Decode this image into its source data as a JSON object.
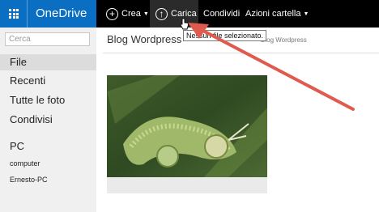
{
  "app": {
    "name": "OneDrive"
  },
  "toolbar": {
    "crea_label": "Crea",
    "carica_label": "Carica",
    "condividi_label": "Condividi",
    "azioni_label": "Azioni cartella"
  },
  "sidebar": {
    "search_placeholder": "Cerca",
    "items": [
      {
        "label": "File"
      },
      {
        "label": "Recenti"
      },
      {
        "label": "Tutte le foto"
      },
      {
        "label": "Condivisi"
      }
    ],
    "pc_header": "PC",
    "pcs": [
      {
        "label": "computer"
      },
      {
        "label": "Ernesto-PC"
      }
    ]
  },
  "main": {
    "breadcrumb": "Blog Wordpress",
    "breadcrumb_faint": "Blog Wordpress"
  },
  "tooltip": {
    "text": "Nessun file selezionato."
  },
  "colors": {
    "brand": "#0a6fc2",
    "annotation_arrow": "#e05a4e"
  },
  "icons": [
    "waffle-icon",
    "plus-icon",
    "upload-icon",
    "cursor-icon",
    "chevron-down-icon"
  ]
}
